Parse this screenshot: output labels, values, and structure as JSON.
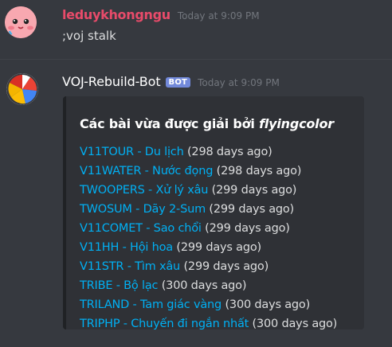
{
  "messages": [
    {
      "username": "leduykhongngu",
      "timestamp": "Today at 9:09 PM",
      "content": ";voj stalk",
      "avatar_icon": "blushing-face-emoji-icon"
    },
    {
      "username": "VOJ-Rebuild-Bot",
      "badge": "BOT",
      "timestamp": "Today at 9:09 PM",
      "avatar_icon": "colorful-segmented-logo-icon",
      "embed": {
        "title_prefix": "Các bài vừa được giải bởi ",
        "title_user": "flyingcolor",
        "problems": [
          {
            "link": "V11TOUR - Du lịch",
            "ago": " (298 days ago)"
          },
          {
            "link": "V11WATER - Nước đọng",
            "ago": " (298 days ago)"
          },
          {
            "link": "TWOOPERS - Xử lý xâu",
            "ago": " (299 days ago)"
          },
          {
            "link": "TWOSUM - Dãy 2-Sum",
            "ago": " (299 days ago)"
          },
          {
            "link": "V11COMET - Sao chổi",
            "ago": " (299 days ago)"
          },
          {
            "link": "V11HH - Hội hoa",
            "ago": " (299 days ago)"
          },
          {
            "link": "V11STR - Tìm xâu",
            "ago": " (299 days ago)"
          },
          {
            "link": "TRIBE - Bộ lạc",
            "ago": " (300 days ago)"
          },
          {
            "link": "TRILAND - Tam giác vàng",
            "ago": " (300 days ago)"
          },
          {
            "link": "TRIPHP - Chuyến đi ngắn nhất",
            "ago": " (300 days ago)"
          }
        ]
      }
    }
  ],
  "colors": {
    "background": "#36393f",
    "embed_bg": "#2f3136",
    "link": "#00b0f4",
    "username_user": "#e84b6a",
    "badge": "#7289da"
  }
}
